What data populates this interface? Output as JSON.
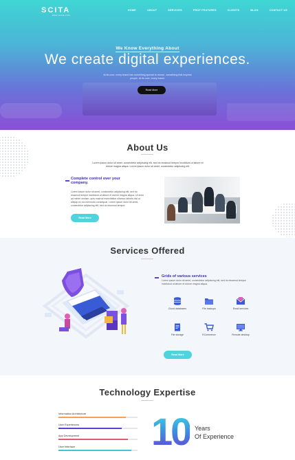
{
  "header": {
    "logo": "SCITA",
    "logo_sub": "www.scita.com",
    "nav": [
      "HOME",
      "ABOUT",
      "SERVICES",
      "PROF FEATURES",
      "CLIENTS",
      "BLOG",
      "CONTACT US"
    ]
  },
  "hero": {
    "kicker": "We Know Everything About",
    "title": "We create digital experiences.",
    "subtitle": "At its core, every brand has something special to reveal - something that inspires people. At its core, every brand.",
    "button": "Read More"
  },
  "about": {
    "title": "About Us",
    "description": "Lorem ipsum dolor sit amet, consectetur adipiscing elit, sed do eiusmod tempor incididunt ut labore et dolore magna aliqua. Lorem ipsum dolor sit amet, consectetur adipiscing elit.",
    "heading": "Complete control over your company.",
    "text": "Lorem ipsum dolor sit amet, consectetur adipiscing elit, sed do eiusmod tempor incididunt ut labore et dolore magna aliqua. Ut enim ad minim veniam, quis nostrud exercitation ullamco laboris nisi ut aliquip ex ea commodo consequat. Lorem ipsum dolor sit amet, consectetur adipiscing elit, sed do eiusmod tempor.",
    "button": "Read More"
  },
  "services": {
    "title": "Services Offered",
    "heading": "Grids of various services",
    "text": "Lorem ipsum dolor sit amet, consectetur adipiscing elit, sed do eiusmod tempor incididunt ut labore et dolore magna aliqua.",
    "features": [
      {
        "label": "Cloud databases",
        "icon": "database-icon"
      },
      {
        "label": "File backups",
        "icon": "folder-icon"
      },
      {
        "label": "Email services",
        "icon": "email-icon"
      },
      {
        "label": "File storage",
        "icon": "file-storage-icon"
      },
      {
        "label": "ECommerce",
        "icon": "cart-icon"
      },
      {
        "label": "Remote desktop",
        "icon": "desktop-icon"
      }
    ],
    "button": "Read More"
  },
  "tech": {
    "title": "Technology Expertise",
    "skills": [
      {
        "name": "Information Architecture",
        "level": 0.85
      },
      {
        "name": "User Experiences",
        "level": 0.8
      },
      {
        "name": "App Development",
        "level": 0.88
      },
      {
        "name": "User Interface",
        "level": 0.92
      }
    ],
    "years_number": "10",
    "years_label_1": "Years",
    "years_label_2": "Of Experience"
  },
  "colors": {
    "accent_purple": "#5b3fd6",
    "accent_teal": "#4fd4de",
    "skill_colors": [
      "#f2a15a",
      "#5b3fd6",
      "#e25a6a",
      "#3cc7d6"
    ]
  }
}
